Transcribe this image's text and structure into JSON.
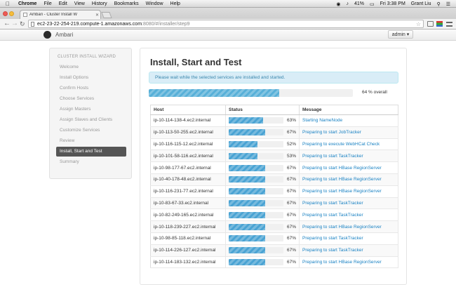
{
  "menubar": {
    "app": "Chrome",
    "items": [
      "File",
      "Edit",
      "View",
      "History",
      "Bookmarks",
      "Window",
      "Help"
    ],
    "battery": "41%",
    "clock": "Fri 3:38 PM",
    "user": "Grant Liu"
  },
  "browser": {
    "tab_title": "Ambari - Cluster Install W",
    "url_host": "ec2-23-22-254-219.compute-1.amazonaws.com",
    "url_path": ":8080/#/installer/step9"
  },
  "app": {
    "brand": "Ambari",
    "user_menu": "admin ▾"
  },
  "wizard": {
    "title": "CLUSTER INSTALL WIZARD",
    "steps": [
      "Welcome",
      "Install Options",
      "Confirm Hosts",
      "Choose Services",
      "Assign Masters",
      "Assign Slaves and Clients",
      "Customize Services",
      "Review",
      "Install, Start and Test",
      "Summary"
    ],
    "active_index": 8
  },
  "main": {
    "title": "Install, Start and Test",
    "notice": "Please wait while the selected services are installed and started.",
    "overall_percent": 64,
    "overall_label": "64 % overall",
    "columns": [
      "Host",
      "Status",
      "Message"
    ],
    "rows": [
      {
        "host": "ip-10-114-138-4.ec2.internal",
        "pct": 63,
        "pct_label": "63%",
        "msg": "Starting NameNode"
      },
      {
        "host": "ip-10-113-50-255.ec2.internal",
        "pct": 67,
        "pct_label": "67%",
        "msg": "Preparing to start JobTracker"
      },
      {
        "host": "ip-10-116-115-12.ec2.internal",
        "pct": 52,
        "pct_label": "52%",
        "msg": "Preparing to execute WebHCat Check"
      },
      {
        "host": "ip-10-101-58-116.ec2.internal",
        "pct": 53,
        "pct_label": "53%",
        "msg": "Preparing to start TaskTracker"
      },
      {
        "host": "ip-10-98-177-67.ec2.internal",
        "pct": 67,
        "pct_label": "67%",
        "msg": "Preparing to start HBase RegionServer"
      },
      {
        "host": "ip-10-40-178-48.ec2.internal",
        "pct": 67,
        "pct_label": "67%",
        "msg": "Preparing to start HBase RegionServer"
      },
      {
        "host": "ip-10-116-231-77.ec2.internal",
        "pct": 67,
        "pct_label": "67%",
        "msg": "Preparing to start HBase RegionServer"
      },
      {
        "host": "ip-10-83-67-33.ec2.internal",
        "pct": 67,
        "pct_label": "67%",
        "msg": "Preparing to start TaskTracker"
      },
      {
        "host": "ip-10-82-249-165.ec2.internal",
        "pct": 67,
        "pct_label": "67%",
        "msg": "Preparing to start TaskTracker"
      },
      {
        "host": "ip-10-118-239-227.ec2.internal",
        "pct": 67,
        "pct_label": "67%",
        "msg": "Preparing to start HBase RegionServer"
      },
      {
        "host": "ip-10-98-85-118.ec2.internal",
        "pct": 67,
        "pct_label": "67%",
        "msg": "Preparing to start TaskTracker"
      },
      {
        "host": "ip-10-114-226-127.ec2.internal",
        "pct": 67,
        "pct_label": "67%",
        "msg": "Preparing to start TaskTracker"
      },
      {
        "host": "ip-10-114-183-132.ec2.internal",
        "pct": 67,
        "pct_label": "67%",
        "msg": "Preparing to start HBase RegionServer"
      }
    ]
  },
  "colors": {
    "accent": "#1a82c3",
    "progress": "#4aa3d3",
    "notice_bg": "#d9edf7",
    "active_step_bg": "#555555"
  }
}
